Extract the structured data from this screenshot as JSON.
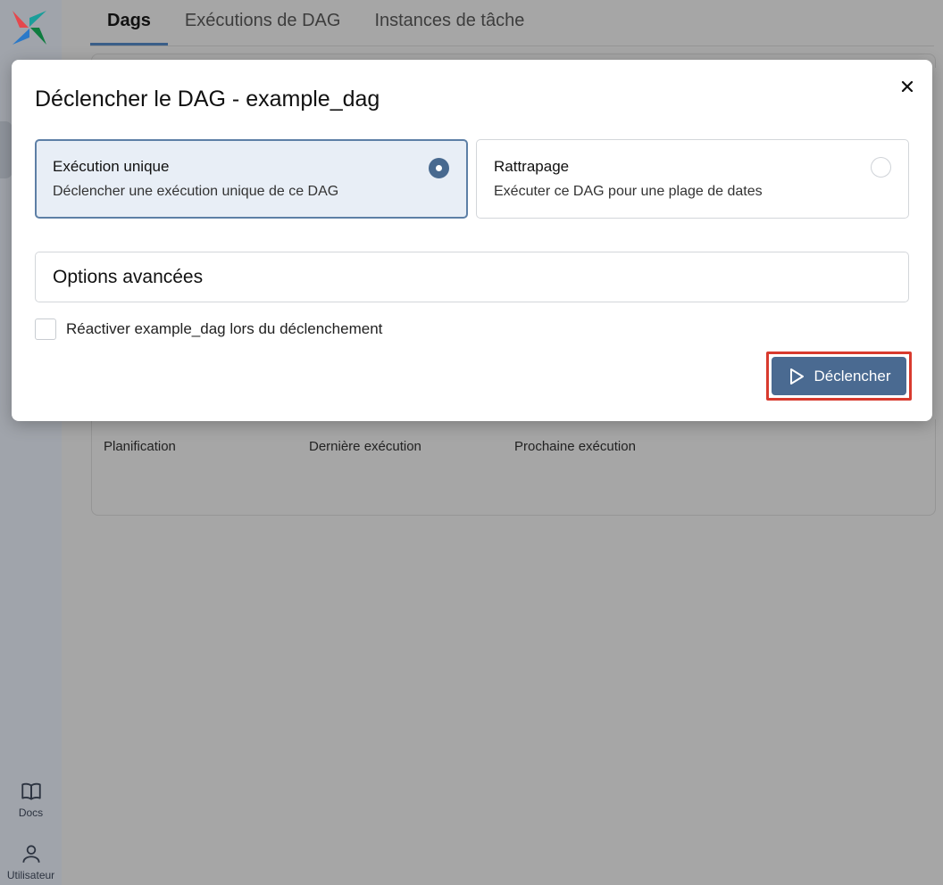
{
  "nav": {
    "tabs": [
      {
        "label": "Dags",
        "active": true
      },
      {
        "label": "Exécutions de DAG",
        "active": false
      },
      {
        "label": "Instances de tâche",
        "active": false
      }
    ]
  },
  "sidebar": {
    "docs_label": "Docs",
    "user_label": "Utilisateur"
  },
  "background_table": {
    "columns": [
      "Planification",
      "Dernière exécution",
      "Prochaine exécution"
    ]
  },
  "modal": {
    "title": "Déclencher le DAG - example_dag",
    "options": [
      {
        "title": "Exécution unique",
        "description": "Déclencher une exécution unique de ce DAG",
        "selected": true
      },
      {
        "title": "Rattrapage",
        "description": "Exécuter ce DAG pour une plage de dates",
        "selected": false
      }
    ],
    "advanced_label": "Options avancées",
    "checkbox_label": "Réactiver example_dag lors du déclenchement",
    "checkbox_checked": false,
    "trigger_label": "Déclencher"
  },
  "colors": {
    "accent": "#4a6a91",
    "highlight": "#d83a2e"
  }
}
